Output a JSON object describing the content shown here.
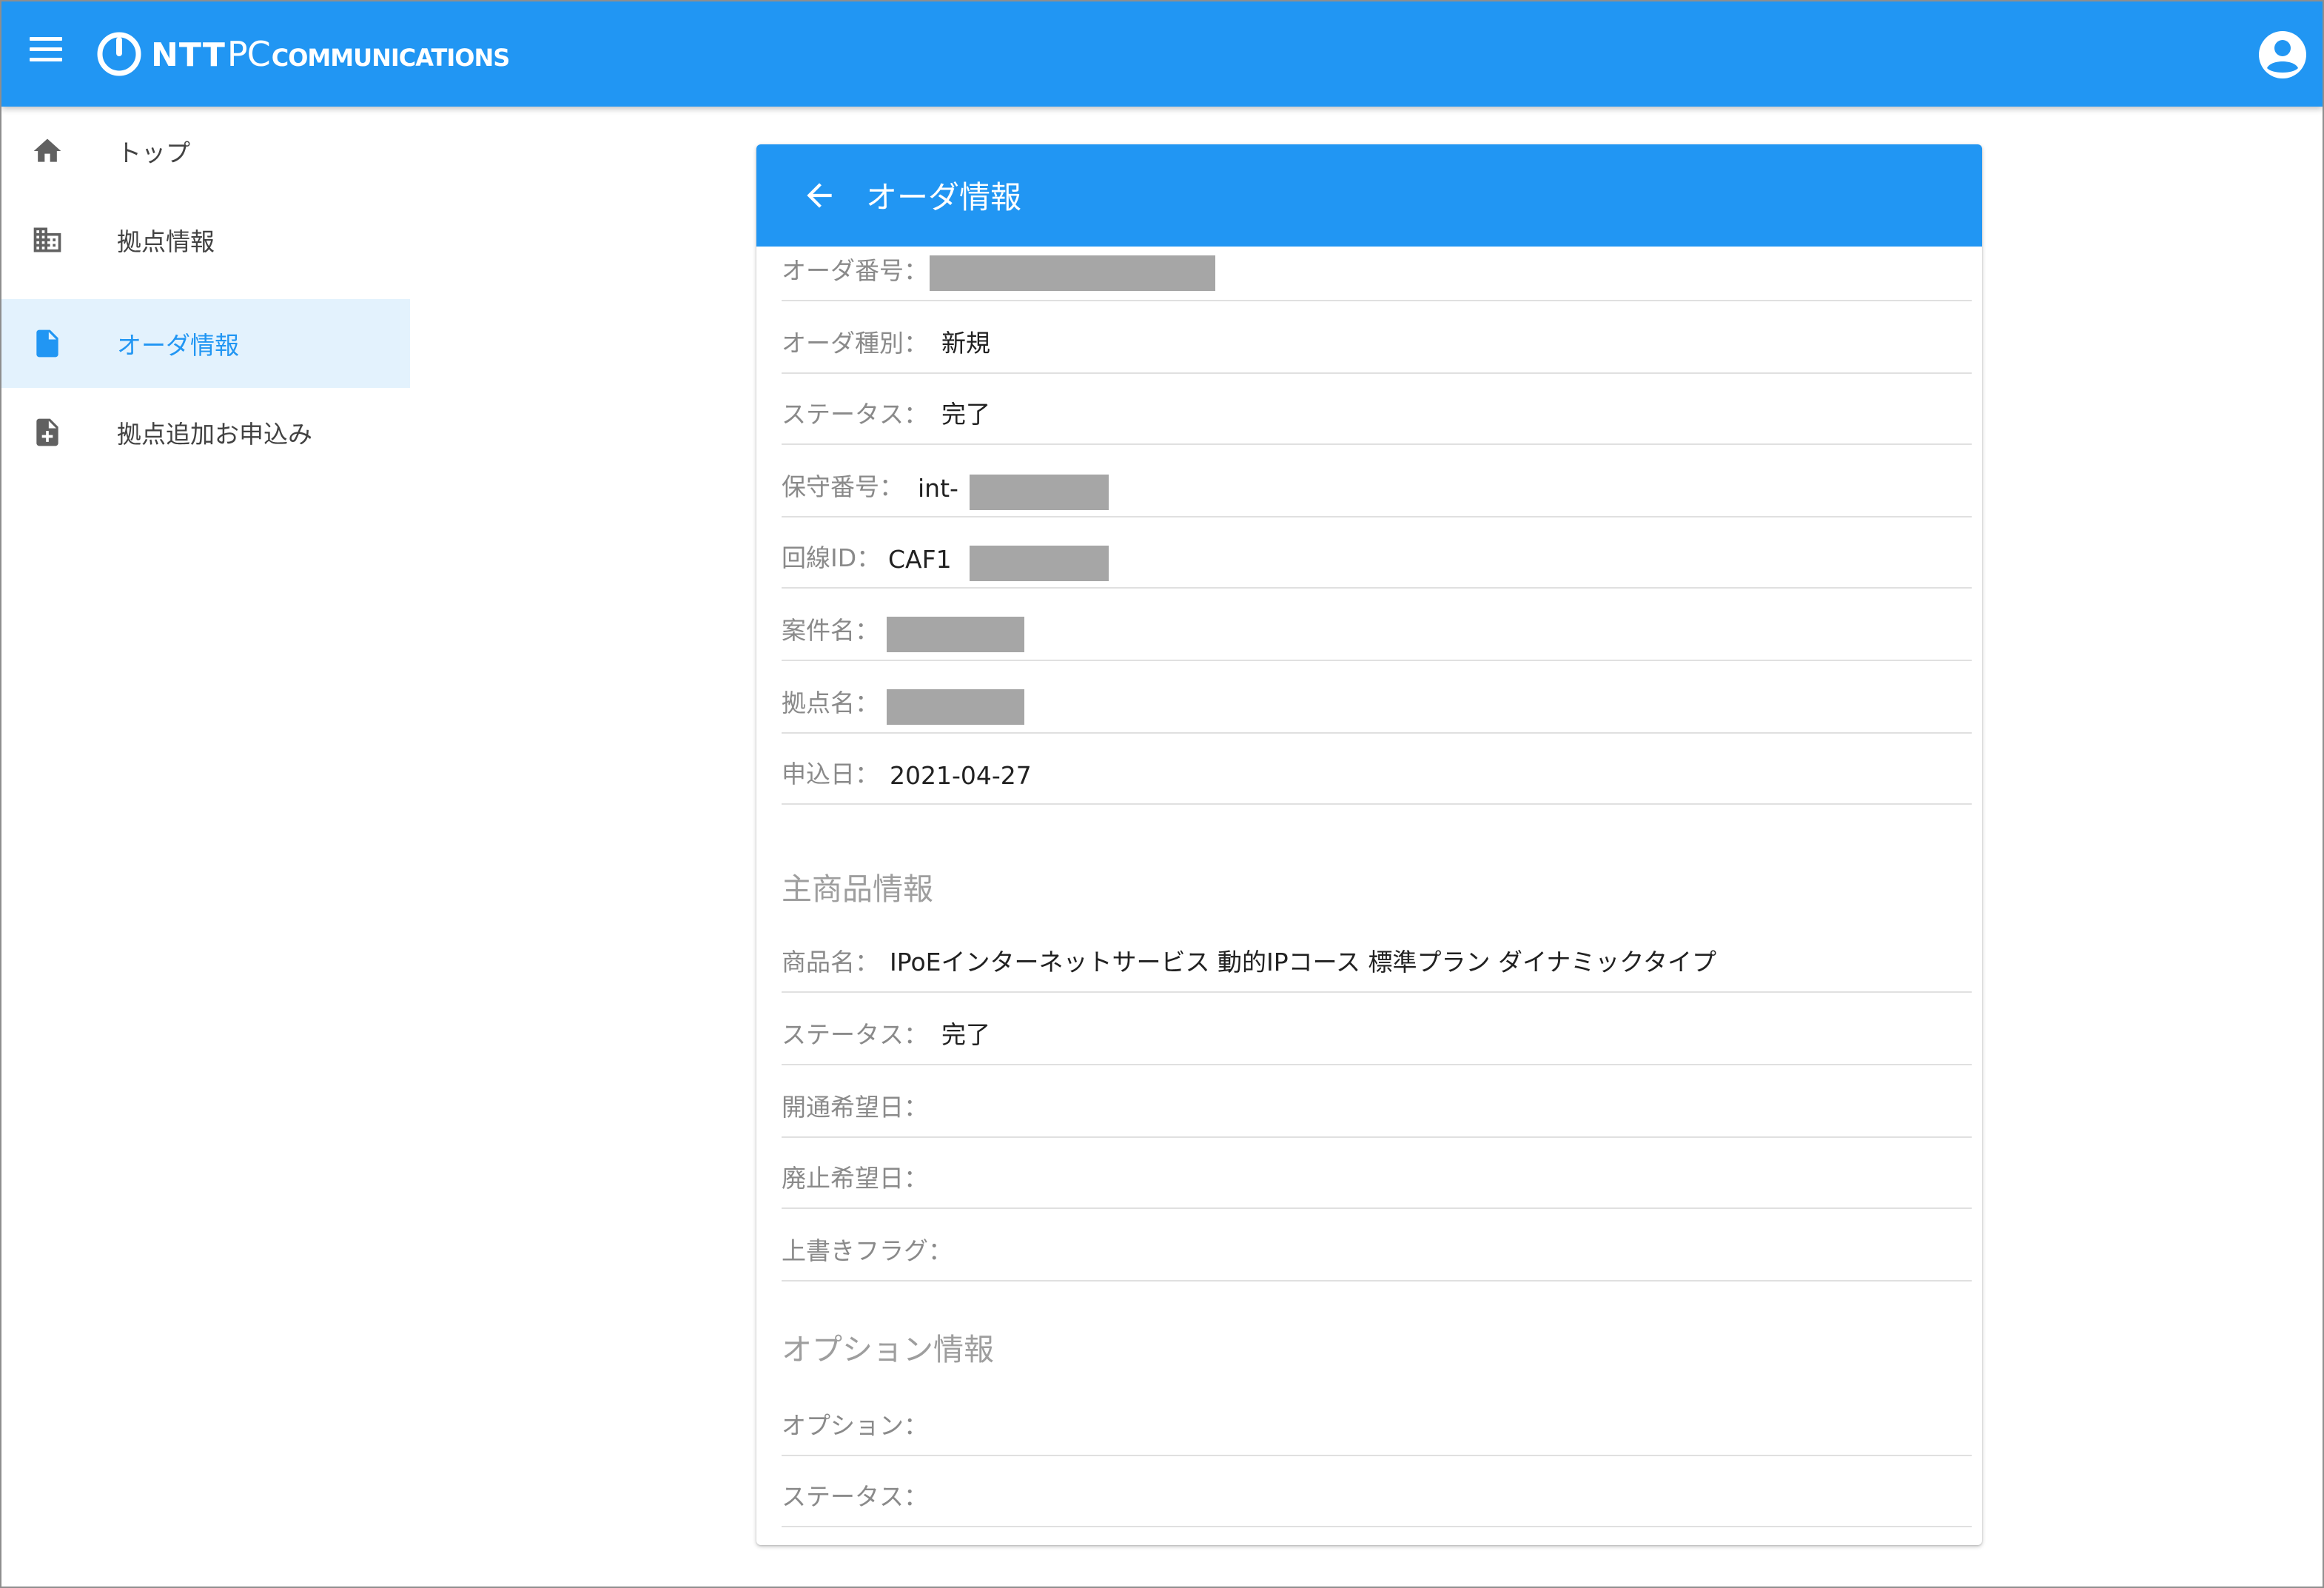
{
  "header": {
    "logo_ntt": "NTT",
    "logo_pc": "PC",
    "logo_comm": "COMMUNICATIONS",
    "menu_icon": "menu-icon",
    "account_icon": "account-circle-icon",
    "brand_color": "#2196f3"
  },
  "sidebar": {
    "items": [
      {
        "label": "トップ",
        "icon": "home-icon"
      },
      {
        "label": "拠点情報",
        "icon": "building-icon"
      },
      {
        "label": "オーダ情報",
        "icon": "document-icon",
        "active": true
      },
      {
        "label": "拠点追加お申込み",
        "icon": "document-add-icon"
      }
    ]
  },
  "card": {
    "title": "オーダ情報",
    "back_icon": "arrow-left-icon",
    "order_number_label": "オーダ番号：",
    "order_type_label": "オーダ種別：",
    "order_type_value": "新規",
    "status_label": "ステータス：",
    "status_value": "完了",
    "maintenance_label": "保守番号：",
    "maintenance_value": "int-",
    "line_id_label": "回線ID：",
    "line_id_value": "CAF1",
    "project_label": "案件名：",
    "site_label": "拠点名：",
    "apply_date_label": "申込日：",
    "apply_date_value": "2021-04-27"
  },
  "main_product": {
    "section_title": "主商品情報",
    "product_label": "商品名：",
    "product_value": "IPoEインターネットサービス 動的IPコース 標準プラン ダイナミックタイプ",
    "status_label": "ステータス：",
    "status_value": "完了",
    "open_date_label": "開通希望日：",
    "close_date_label": "廃止希望日：",
    "overwrite_label": "上書きフラグ："
  },
  "option": {
    "section_title": "オプション情報",
    "option_label": "オプション：",
    "status_label": "ステータス："
  }
}
